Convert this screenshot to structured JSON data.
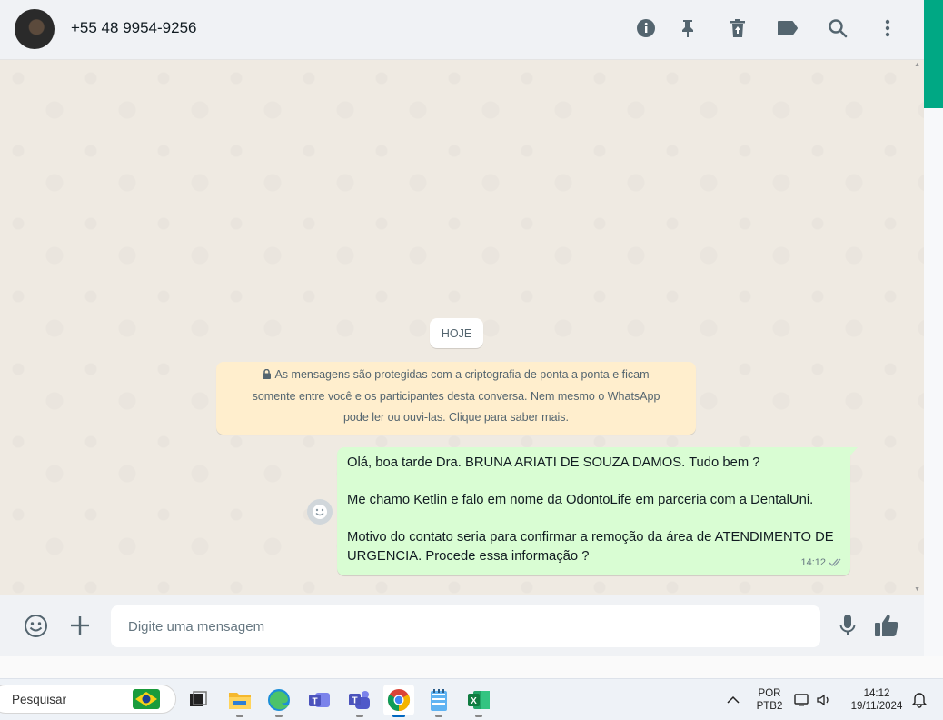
{
  "header": {
    "contact_name": "+55 48 9954-9256",
    "icons": [
      "info-icon",
      "pin-icon",
      "delete-icon",
      "label-icon",
      "search-icon",
      "menu-icon"
    ]
  },
  "chat": {
    "date_chip": "HOJE",
    "encryption_lines": [
      "As mensagens são protegidas com a criptografia de ponta a ponta e ficam",
      "somente entre você e os participantes desta conversa. Nem mesmo o WhatsApp",
      "pode ler ou ouvi-las. Clique para saber mais."
    ],
    "message": {
      "line1": "Olá, boa tarde Dra. BRUNA ARIATI DE SOUZA DAMOS. Tudo bem ?",
      "line2": "Me chamo Ketlin e falo em nome da OdontoLife em parceria com a DentalUni.",
      "line3": "Motivo do contato seria para confirmar a remoção da área de ATENDIMENTO DE URGENCIA. Procede essa informação ?",
      "time": "14:12",
      "status": "read"
    }
  },
  "footer": {
    "placeholder": "Digite uma mensagem",
    "value": ""
  },
  "taskbar": {
    "search_label": "Pesquisar",
    "apps": [
      "task-view",
      "file-explorer",
      "edge",
      "teams",
      "teams-new",
      "chrome",
      "notepad",
      "excel"
    ],
    "active_app": "chrome",
    "language_line1": "POR",
    "language_line2": "PTB2",
    "time": "14:12",
    "date": "19/11/2024"
  },
  "colors": {
    "accent_green": "#00a884",
    "outgoing_bubble": "#d9fdd3",
    "encryption_note": "#ffeecd",
    "chat_background": "#efeae2"
  }
}
